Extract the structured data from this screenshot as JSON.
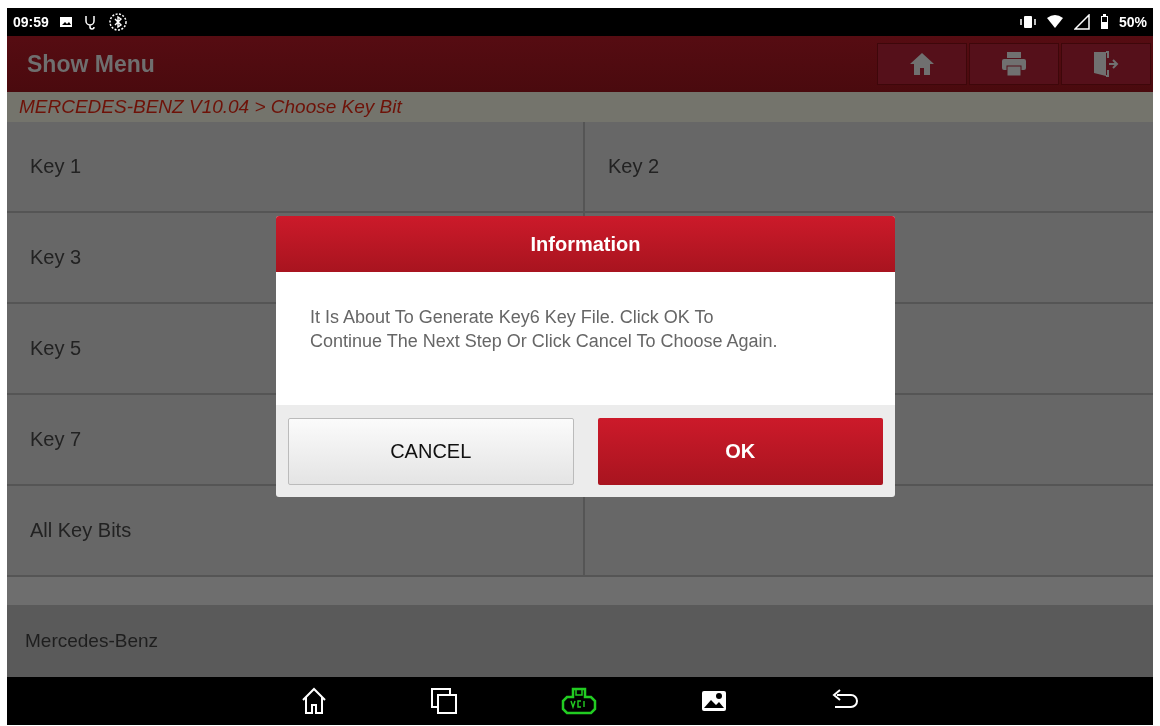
{
  "status_bar": {
    "time": "09:59",
    "battery": "50%"
  },
  "header": {
    "title": "Show Menu"
  },
  "breadcrumb": "MERCEDES-BENZ V10.04 > Choose Key Bit",
  "rows": [
    {
      "left": "Key 1",
      "right": "Key 2"
    },
    {
      "left": "Key 3"
    },
    {
      "left": "Key 5"
    },
    {
      "left": "Key 7"
    },
    {
      "left": "All Key Bits"
    }
  ],
  "footer": "Mercedes-Benz",
  "dialog": {
    "title": "Information",
    "message": "It Is About To Generate Key6 Key File. Click OK To Continue The Next Step Or Click Cancel To Choose Again.",
    "buttons": [
      {
        "label": "CANCEL",
        "kind": "secondary"
      },
      {
        "label": "OK",
        "kind": "primary"
      }
    ]
  }
}
